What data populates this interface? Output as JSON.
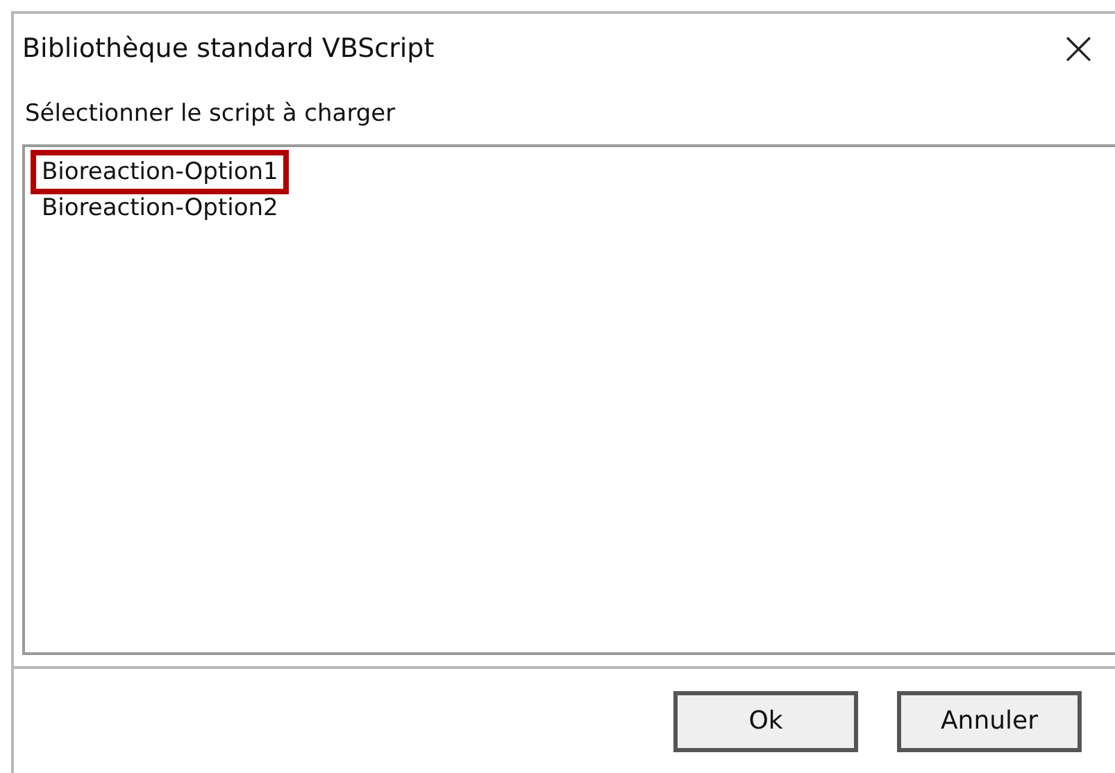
{
  "window": {
    "title": "Bibliothèque standard VBScript",
    "close": "×"
  },
  "prompt": "Sélectionner le script à charger",
  "scripts": [
    {
      "name": "Bioreaction-Option1",
      "highlighted": true
    },
    {
      "name": "Bioreaction-Option2",
      "highlighted": false
    }
  ],
  "buttons": [
    "Ok",
    "Annuler"
  ]
}
